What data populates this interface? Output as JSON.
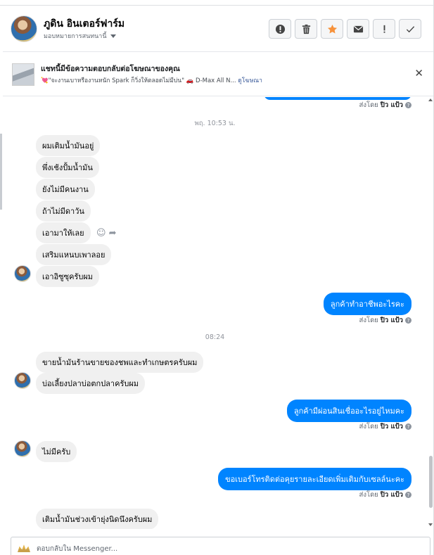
{
  "header": {
    "contact_name": "ภูดิน อินเตอร์ฟาร์ม",
    "assign_label": "มอบหมายการสนทนานี้",
    "actions": [
      {
        "name": "spam-icon"
      },
      {
        "name": "trash-icon"
      },
      {
        "name": "star-icon",
        "color": "#f7923b"
      },
      {
        "name": "envelope-icon"
      },
      {
        "name": "exclamation-icon"
      },
      {
        "name": "check-icon"
      }
    ]
  },
  "ad_banner": {
    "title": "แชทนี้มีข้อความตอบกลับต่อโฆษณาของคุณ",
    "subtitle": "💘\"จะงานเบาหรืองานหนัก Spark ก็วิ่งให้ตลอดไม่มีบ่น\" 🚗 D-Max All N...",
    "link_label": "ดูโฆษณา",
    "close_icon": "close-icon"
  },
  "messages": {
    "sent_by_prefix": "ส่งโดย",
    "sent_by_name": "ปิว แป้ว",
    "time_1": "พฤ. 10:53 น.",
    "time_2": "08:24",
    "incoming_1": [
      "ผมเติมน้ำมันอยู่",
      "พึ่งเช้งปั้มน้ำมัน",
      "ยังไม่มีคนงาน",
      "ถ้าไม่มีดาวัน",
      "เอามาให้เลย",
      "เสริมแหนบเพาลอย",
      "เอาอิซูซุครับผม"
    ],
    "outgoing_1": "ลูกค้าทำอาชีพอะไรคะ",
    "incoming_2": [
      "ขายน้ำมันร้านขายของชพและทำเกษตรครับผม",
      "บ่อเลี้ยงปลาบ่อตกปลาครับผม"
    ],
    "outgoing_2": "ลูกค้ามีผ่อนสินเชื่ออะไรอยู่ไหมคะ",
    "incoming_3": "ไม่มีครับ",
    "outgoing_3": "ขอเบอร์โทรติดต่อคุยรายละเอียดเพิ่มเติมกับเซลล์นะคะ",
    "incoming_4": "เติมน้ำมันช่วงเข้ายุ่งนิดนึงครับผม"
  },
  "composer": {
    "placeholder": "ตอบกลับใน Messenger..."
  }
}
